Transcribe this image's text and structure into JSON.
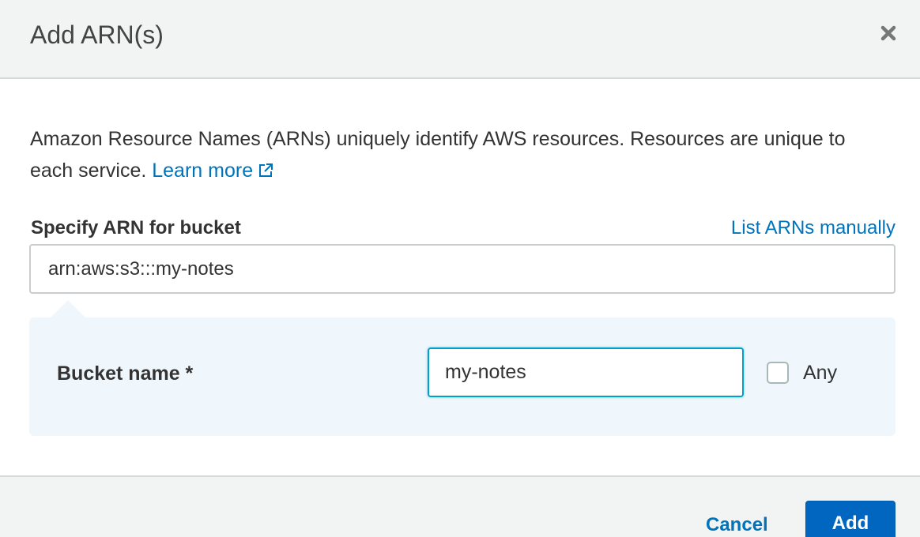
{
  "dialog": {
    "title": "Add ARN(s)",
    "close_icon": "close-icon"
  },
  "body": {
    "description": "Amazon Resource Names (ARNs) uniquely identify AWS resources. Resources are unique to each service.",
    "learn_more_label": "Learn more",
    "learn_more_icon": "external-link-icon",
    "arn_field": {
      "label": "Specify ARN for bucket",
      "value": "arn:aws:s3:::my-notes"
    },
    "list_manually_label": "List ARNs manually",
    "builder": {
      "bucket_name_label": "Bucket name *",
      "bucket_name_value": "my-notes",
      "any_checkbox_checked": false,
      "any_label": "Any"
    }
  },
  "footer": {
    "cancel_label": "Cancel",
    "add_label": "Add"
  },
  "colors": {
    "link": "#0073bb",
    "primary_button": "#0066c0",
    "builder_background": "#f0f7fc",
    "focus_border": "#00a1c9"
  }
}
